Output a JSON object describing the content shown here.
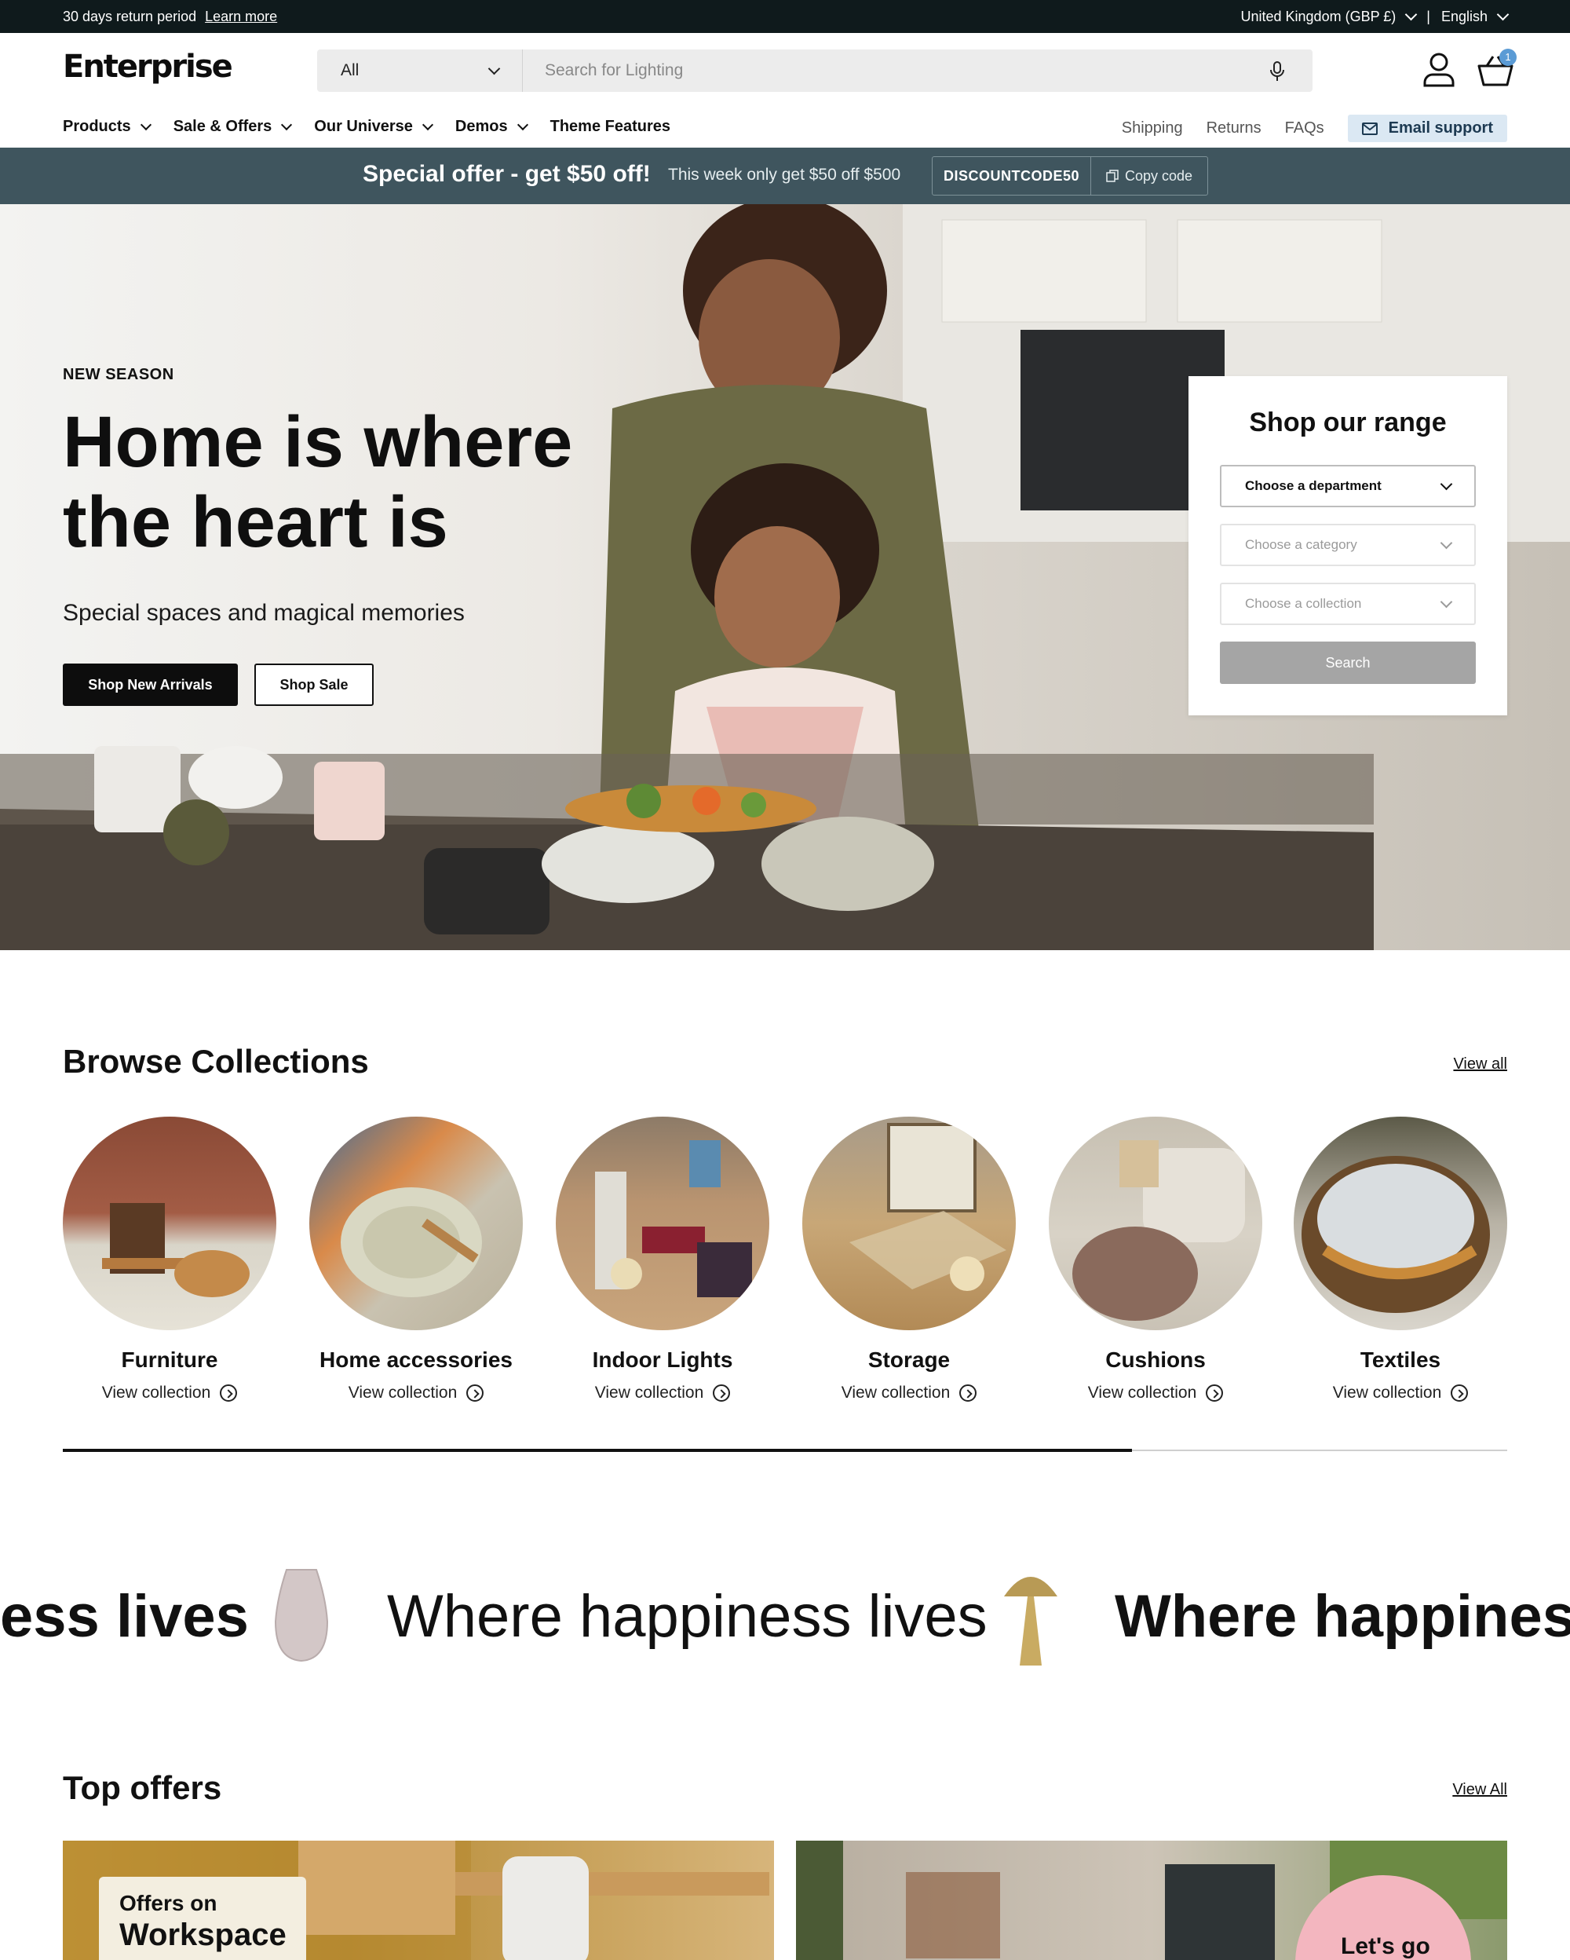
{
  "announcement": {
    "text": "30 days return period",
    "link": "Learn more",
    "country": "United Kingdom (GBP £)",
    "separator": "|",
    "language": "English"
  },
  "header": {
    "logo": "Enterprise",
    "search_select": "All",
    "search_placeholder": "Search for Lighting",
    "cart_count": "1"
  },
  "nav": {
    "items": [
      {
        "label": "Products",
        "dropdown": true
      },
      {
        "label": "Sale & Offers",
        "dropdown": true
      },
      {
        "label": "Our Universe",
        "dropdown": true
      },
      {
        "label": "Demos",
        "dropdown": true
      },
      {
        "label": "Theme Features",
        "dropdown": false
      }
    ],
    "links": [
      "Shipping",
      "Returns",
      "FAQs"
    ],
    "email_support": "Email support"
  },
  "promo": {
    "title": "Special offer - get $50 off!",
    "text": "This week only get $50 off $500",
    "code": "DISCOUNTCODE50",
    "copy_label": "Copy code"
  },
  "hero": {
    "eyebrow": "NEW SEASON",
    "title": "Home is where the heart is",
    "subtitle": "Special spaces and magical memories",
    "primary_button": "Shop New Arrivals",
    "secondary_button": "Shop Sale"
  },
  "range_finder": {
    "title": "Shop our range",
    "department": "Choose a department",
    "category": "Choose a category",
    "collection": "Choose a collection",
    "search": "Search"
  },
  "collections": {
    "title": "Browse Collections",
    "view_all": "View all",
    "link_label": "View collection",
    "items": [
      {
        "name": "Furniture"
      },
      {
        "name": "Home accessories"
      },
      {
        "name": "Indoor Lights"
      },
      {
        "name": "Storage"
      },
      {
        "name": "Cushions"
      },
      {
        "name": "Textiles"
      }
    ],
    "scroll_progress": 0.74
  },
  "marquee": {
    "fragment_left": "ess lives",
    "middle": "Where happiness lives",
    "fragment_right": "Where happiness"
  },
  "offers": {
    "title": "Top offers",
    "view_all": "View All",
    "card1_line1": "Offers on",
    "card1_line2": "Workspace",
    "card2_badge": "Let's go"
  },
  "colors": {
    "topbar": "#0f1a1c",
    "promo": "#3f555e",
    "email_support_bg": "#dbe8f3",
    "cart_badge": "#5b9bd5",
    "primary_button": "#0d0d0d"
  }
}
